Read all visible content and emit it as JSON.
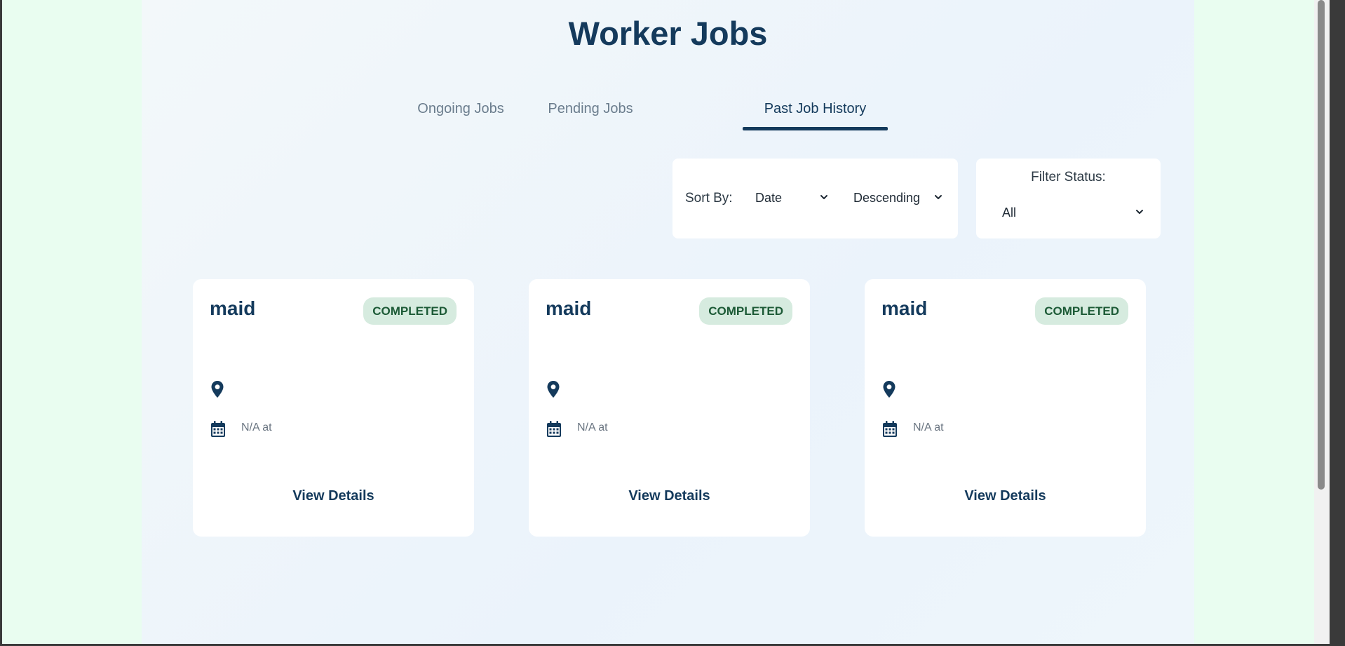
{
  "page": {
    "title": "Worker Jobs"
  },
  "tabs": [
    {
      "label": "Ongoing Jobs",
      "active": false
    },
    {
      "label": "Pending Jobs",
      "active": false
    },
    {
      "label": "Past Job History",
      "active": true
    }
  ],
  "sort": {
    "label": "Sort By:",
    "field": "Date",
    "order": "Descending"
  },
  "filter": {
    "label": "Filter Status:",
    "value": "All"
  },
  "jobs": [
    {
      "title": "maid",
      "status": "COMPLETED",
      "location": "",
      "date": "N/A at",
      "action": "View Details"
    },
    {
      "title": "maid",
      "status": "COMPLETED",
      "location": "",
      "date": "N/A at",
      "action": "View Details"
    },
    {
      "title": "maid",
      "status": "COMPLETED",
      "location": "",
      "date": "N/A at",
      "action": "View Details"
    }
  ],
  "colors": {
    "primary": "#143a5c",
    "badge_bg": "#d6ebdf",
    "badge_text": "#1c5a36",
    "outer_bg": "#e9fdf0"
  },
  "icons": {
    "location": "map-pin-icon",
    "date": "calendar-icon",
    "dropdown": "chevron-down-icon"
  }
}
